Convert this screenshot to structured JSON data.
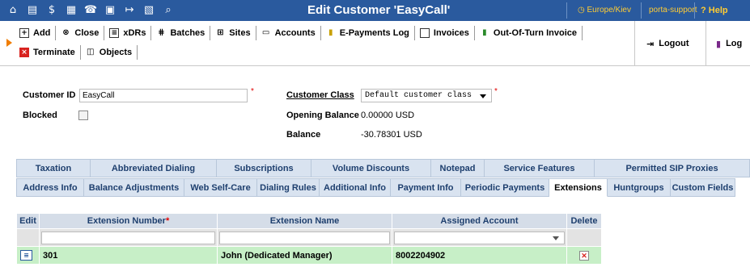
{
  "header": {
    "title": "Edit Customer 'EasyCall'",
    "timezone": "Europe/Kiev",
    "user": "porta-support",
    "help_label": "Help",
    "icons": [
      "home-icon",
      "list-icon",
      "dollar-icon",
      "grid-icon",
      "phone-icon",
      "calls-icon",
      "forward-icon",
      "chart-icon",
      "search-icon"
    ]
  },
  "toolbar": {
    "row1": [
      {
        "icon": "add-icon",
        "label": "Add"
      },
      {
        "icon": "close-icon",
        "label": "Close"
      },
      {
        "icon": "xdrs-icon",
        "label": "xDRs"
      },
      {
        "icon": "batches-icon",
        "label": "Batches"
      },
      {
        "icon": "sites-icon",
        "label": "Sites"
      },
      {
        "icon": "accounts-icon",
        "label": "Accounts"
      },
      {
        "icon": "epayments-icon",
        "label": "E-Payments Log"
      },
      {
        "icon": "invoices-icon",
        "label": "Invoices"
      },
      {
        "icon": "out-of-turn-invoice-icon",
        "label": "Out-Of-Turn Invoice"
      }
    ],
    "row2": [
      {
        "icon": "terminate-icon",
        "label": "Terminate"
      },
      {
        "icon": "objects-icon",
        "label": "Objects"
      }
    ],
    "logout_label": "Logout",
    "log_label": "Log"
  },
  "form": {
    "customer_id_label": "Customer ID",
    "customer_id_value": "EasyCall",
    "blocked_label": "Blocked",
    "customer_class_label": "Customer Class",
    "customer_class_value": "Default customer class",
    "opening_balance_label": "Opening Balance",
    "opening_balance_value": "0.00000 USD",
    "balance_label": "Balance",
    "balance_value": "-30.78301 USD",
    "required_mark": "*"
  },
  "tabs_row1": [
    {
      "label": "Taxation"
    },
    {
      "label": "Abbreviated Dialing"
    },
    {
      "label": "Subscriptions"
    },
    {
      "label": "Volume Discounts"
    },
    {
      "label": "Notepad"
    },
    {
      "label": "Service Features"
    },
    {
      "label": "Permitted SIP Proxies"
    }
  ],
  "tabs_row2": [
    {
      "label": "Address Info"
    },
    {
      "label": "Balance Adjustments"
    },
    {
      "label": "Web Self-Care"
    },
    {
      "label": "Dialing Rules"
    },
    {
      "label": "Additional Info"
    },
    {
      "label": "Payment Info"
    },
    {
      "label": "Periodic Payments"
    },
    {
      "label": "Extensions",
      "active": true
    },
    {
      "label": "Huntgroups"
    },
    {
      "label": "Custom Fields"
    }
  ],
  "extensions_table": {
    "columns": {
      "edit": "Edit",
      "extension_number": "Extension Number",
      "extension_name": "Extension Name",
      "assigned_account": "Assigned Account",
      "delete": "Delete"
    },
    "rows": [
      {
        "extension_number": "301",
        "extension_name": "John (Dedicated Manager)",
        "assigned_account": "8002204902"
      }
    ]
  },
  "colors": {
    "header_bg": "#2a5a9e",
    "accent_yellow": "#ffcc33",
    "tab_bg": "#d9e3f0",
    "row_green": "#c7efc7",
    "required_red": "#e00000"
  }
}
